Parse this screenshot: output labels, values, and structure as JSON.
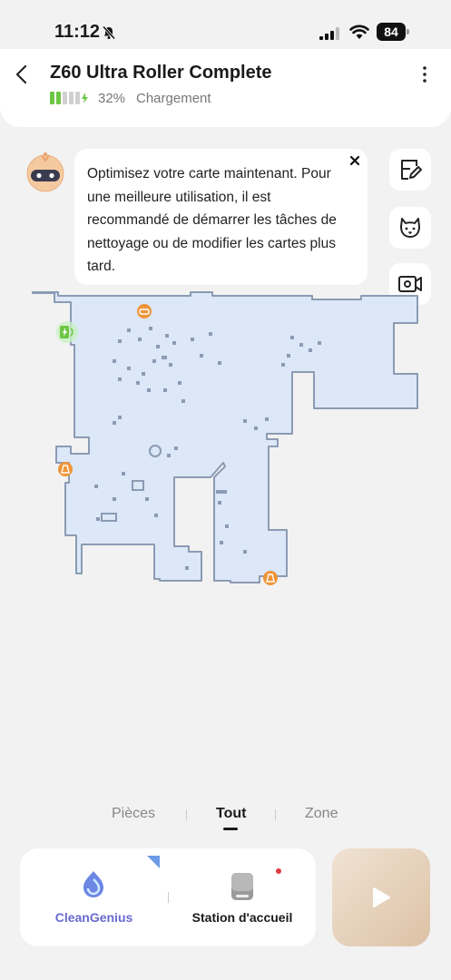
{
  "status_bar": {
    "time": "11:12",
    "battery": "84"
  },
  "header": {
    "title": "Z60 Ultra Roller Complete",
    "battery_percent": "32%",
    "status": "Chargement"
  },
  "tip": {
    "text": "Optimisez votre carte maintenant. Pour une meilleure utilisation, il est recommandé de démarrer les tâches de nettoyage ou de modifier les cartes plus tard."
  },
  "side_buttons": [
    {
      "icon": "edit-map-icon"
    },
    {
      "icon": "pet-icon"
    },
    {
      "icon": "video-camera-icon"
    }
  ],
  "tabs": {
    "rooms": "Pièces",
    "all": "Tout",
    "zone": "Zone",
    "active": "all"
  },
  "bottom": {
    "clean_genius": "CleanGenius",
    "station": "Station d'accueil"
  },
  "colors": {
    "map_fill": "#dce7f7",
    "map_stroke": "#8a9bb3",
    "accent_orange": "#f0953a",
    "clean_genius": "#6a6ad0",
    "charge_green": "#6cc644"
  }
}
